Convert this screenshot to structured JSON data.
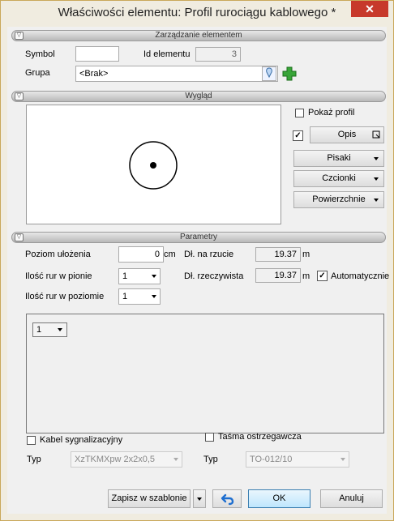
{
  "window": {
    "title": "Właściwości elementu: Profil rurociągu kablowego *",
    "close_label": "✕"
  },
  "sections": {
    "management": "Zarządzanie elementem",
    "appearance": "Wygląd",
    "params": "Parametry"
  },
  "management": {
    "symbol_label": "Symbol",
    "symbol_value": "",
    "id_label": "Id elementu",
    "id_value": "3",
    "group_label": "Grupa",
    "group_value": "<Brak>"
  },
  "appearance": {
    "show_profile_label": "Pokaż profil",
    "show_profile_checked": false,
    "description_checked": true,
    "description_button": "Opis",
    "pens_button": "Pisaki",
    "fonts_button": "Czcionki",
    "surfaces_button": "Powierzchnie"
  },
  "params": {
    "level_label": "Poziom ułożenia",
    "level_value": "0",
    "level_unit": "cm",
    "proj_len_label": "Dł. na rzucie",
    "proj_len_value": "19.37",
    "proj_len_unit": "m",
    "vertical_label": "Ilość rur w pionie",
    "vertical_value": "1",
    "real_len_label": "Dł. rzeczywista",
    "real_len_value": "19.37",
    "real_len_unit": "m",
    "auto_label": "Automatycznie",
    "auto_checked": true,
    "horizontal_label": "Ilość rur w poziomie",
    "horizontal_value": "1",
    "grid_select_value": "1"
  },
  "cables": {
    "signal_label": "Kabel sygnalizacyjny",
    "signal_checked": false,
    "tape_label": "Taśma ostrzegawcza",
    "tape_checked": false,
    "type_label_1": "Typ",
    "type_value_1": "XzTKMXpw 2x2x0,5",
    "type_label_2": "Typ",
    "type_value_2": "TO-012/10"
  },
  "footer": {
    "save_template": "Zapisz w szablonie",
    "ok": "OK",
    "cancel": "Anuluj"
  }
}
